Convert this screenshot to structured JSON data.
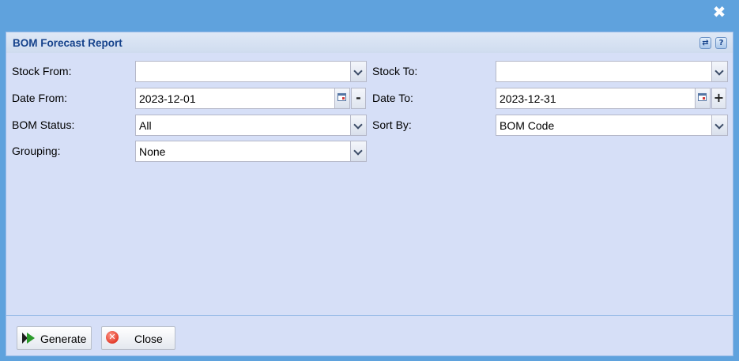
{
  "window": {
    "close_icon": "close-icon",
    "close_glyph": "✖"
  },
  "panel": {
    "title": "BOM Forecast Report",
    "tools": [
      {
        "name": "refresh-icon",
        "glyph": "⇄"
      },
      {
        "name": "help-icon",
        "glyph": "?"
      }
    ]
  },
  "form": {
    "stock_from": {
      "label": "Stock From:",
      "value": ""
    },
    "stock_to": {
      "label": "Stock To:",
      "value": ""
    },
    "date_from": {
      "label": "Date From:",
      "value": "2023-12-01",
      "adjust": "-"
    },
    "date_to": {
      "label": "Date To:",
      "value": "2023-12-31",
      "adjust": "+"
    },
    "bom_status": {
      "label": "BOM Status:",
      "value": "All"
    },
    "sort_by": {
      "label": "Sort By:",
      "value": "BOM Code"
    },
    "grouping": {
      "label": "Grouping:",
      "value": "None"
    }
  },
  "footer": {
    "generate_label": "Generate",
    "close_label": "Close",
    "close_glyph": "✕"
  },
  "colors": {
    "window_bg": "#5fa2dd",
    "panel_bg": "#d6dff7",
    "title_color": "#15428b",
    "generate_icon": "#2c9b2c"
  }
}
